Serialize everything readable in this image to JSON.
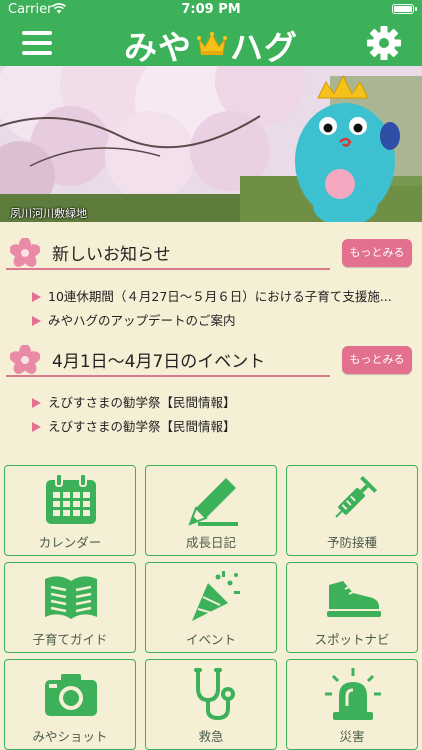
{
  "status_bar": {
    "carrier": "Carrier",
    "time": "7:09 PM"
  },
  "header": {
    "title": "みやハグ",
    "title_left": "みや",
    "title_right": "ハグ"
  },
  "hero": {
    "caption": "夙川河川敷緑地"
  },
  "news": {
    "title": "新しいお知らせ",
    "more_label": "もっとみる",
    "items": [
      "10連休期間（４月27日〜５月６日）における子育て支援施...",
      "みやハグのアップデートのご案内"
    ]
  },
  "events": {
    "title": "4月1日〜4月7日のイベント",
    "more_label": "もっとみる",
    "items": [
      "えびすさまの勧学祭【民間情報】",
      "えびすさまの勧学祭【民間情報】"
    ]
  },
  "menu": [
    {
      "label": "カレンダー",
      "icon": "calendar-icon"
    },
    {
      "label": "成長日記",
      "icon": "pencil-icon"
    },
    {
      "label": "予防接種",
      "icon": "syringe-icon"
    },
    {
      "label": "子育てガイド",
      "icon": "book-icon"
    },
    {
      "label": "イベント",
      "icon": "party-popper-icon"
    },
    {
      "label": "スポットナビ",
      "icon": "sneaker-icon"
    },
    {
      "label": "みやショット",
      "icon": "camera-icon"
    },
    {
      "label": "救急",
      "icon": "stethoscope-icon"
    },
    {
      "label": "災害",
      "icon": "siren-icon"
    }
  ],
  "colors": {
    "brand_green": "#3cb15a",
    "accent_pink": "#e3708e",
    "background": "#f5efd6"
  }
}
